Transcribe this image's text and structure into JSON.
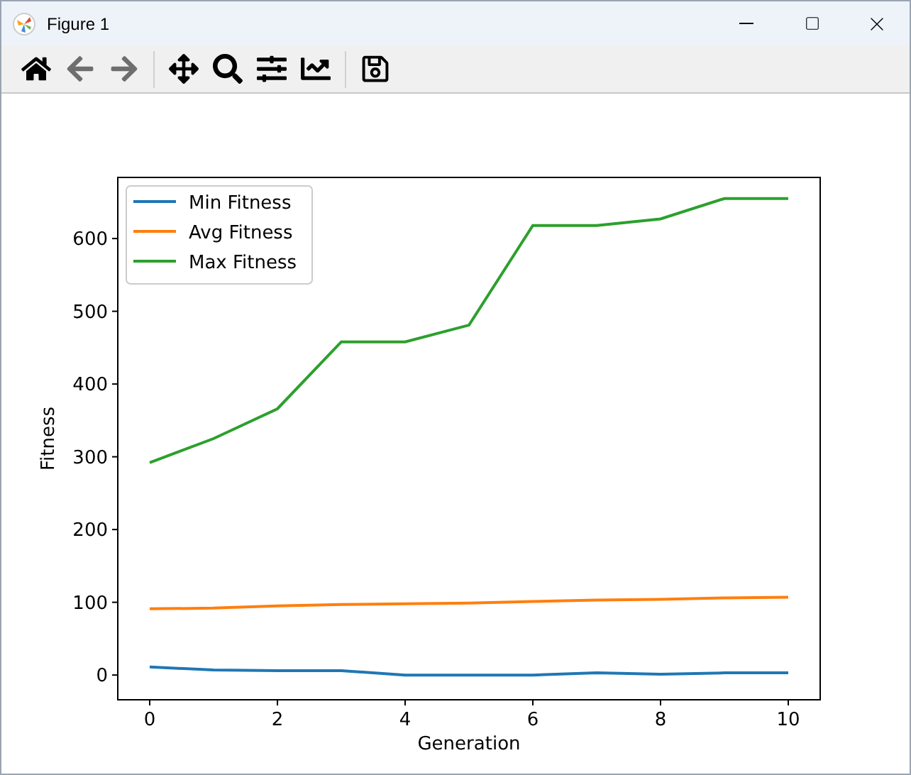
{
  "window": {
    "title": "Figure 1"
  },
  "toolbar": [
    {
      "kind": "home",
      "disabled": false
    },
    {
      "kind": "back",
      "disabled": true
    },
    {
      "kind": "forward",
      "disabled": true
    },
    {
      "kind": "pan",
      "disabled": false
    },
    {
      "kind": "zoom",
      "disabled": false
    },
    {
      "kind": "subplots",
      "disabled": false
    },
    {
      "kind": "axes",
      "disabled": false
    },
    {
      "kind": "save",
      "disabled": false
    }
  ],
  "chart_data": {
    "type": "line",
    "xlabel": "Generation",
    "ylabel": "Fitness",
    "x": [
      0,
      1,
      2,
      3,
      4,
      5,
      6,
      7,
      8,
      9,
      10
    ],
    "xlim": [
      -0.5,
      10.5
    ],
    "ylim": [
      -34,
      684
    ],
    "xticks": [
      0,
      2,
      4,
      6,
      8,
      10
    ],
    "yticks": [
      0,
      100,
      200,
      300,
      400,
      500,
      600
    ],
    "legend": true,
    "series": [
      {
        "name": "Min Fitness",
        "color": "#1f77b4",
        "values": [
          11,
          7,
          6,
          6,
          0,
          0,
          0,
          3,
          1,
          3,
          3
        ]
      },
      {
        "name": "Avg Fitness",
        "color": "#ff7f0e",
        "values": [
          91,
          92,
          95,
          97,
          98,
          99,
          101,
          103,
          104,
          106,
          107
        ]
      },
      {
        "name": "Max Fitness",
        "color": "#2ca02c",
        "values": [
          292,
          325,
          366,
          458,
          458,
          481,
          618,
          618,
          627,
          655,
          655
        ]
      }
    ]
  }
}
